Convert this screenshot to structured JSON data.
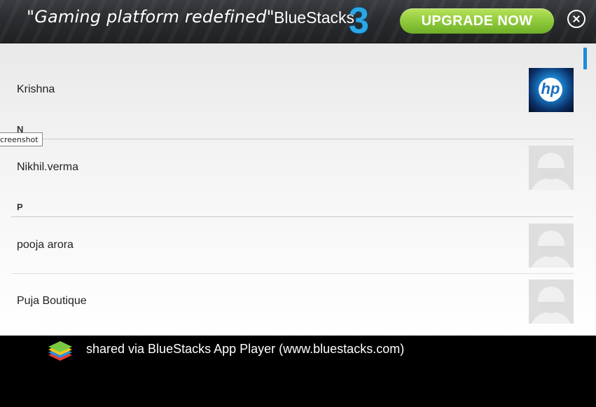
{
  "ad_banner": {
    "slogan": "\"Gaming platform redefined\"",
    "brand": "BlueStacks",
    "brand_version": "3",
    "upgrade_label": "UPGRADE NOW",
    "close_icon": "close-circle-icon"
  },
  "contacts": {
    "rows": [
      {
        "name": "Krishna",
        "avatar": "hp-logo",
        "avatar_text": "hp"
      },
      {
        "name": "Nikhil.verma",
        "avatar": "default-avatar"
      },
      {
        "name": "pooja arora",
        "avatar": "default-avatar"
      },
      {
        "name": "Puja Boutique",
        "avatar": "default-avatar"
      }
    ],
    "sections": [
      "N",
      "P"
    ]
  },
  "tooltip": {
    "text": "creenshot"
  },
  "footer": {
    "text": "shared via BlueStacks App Player (www.bluestacks.com)",
    "logo_icon": "bluestacks-logo-icon"
  }
}
